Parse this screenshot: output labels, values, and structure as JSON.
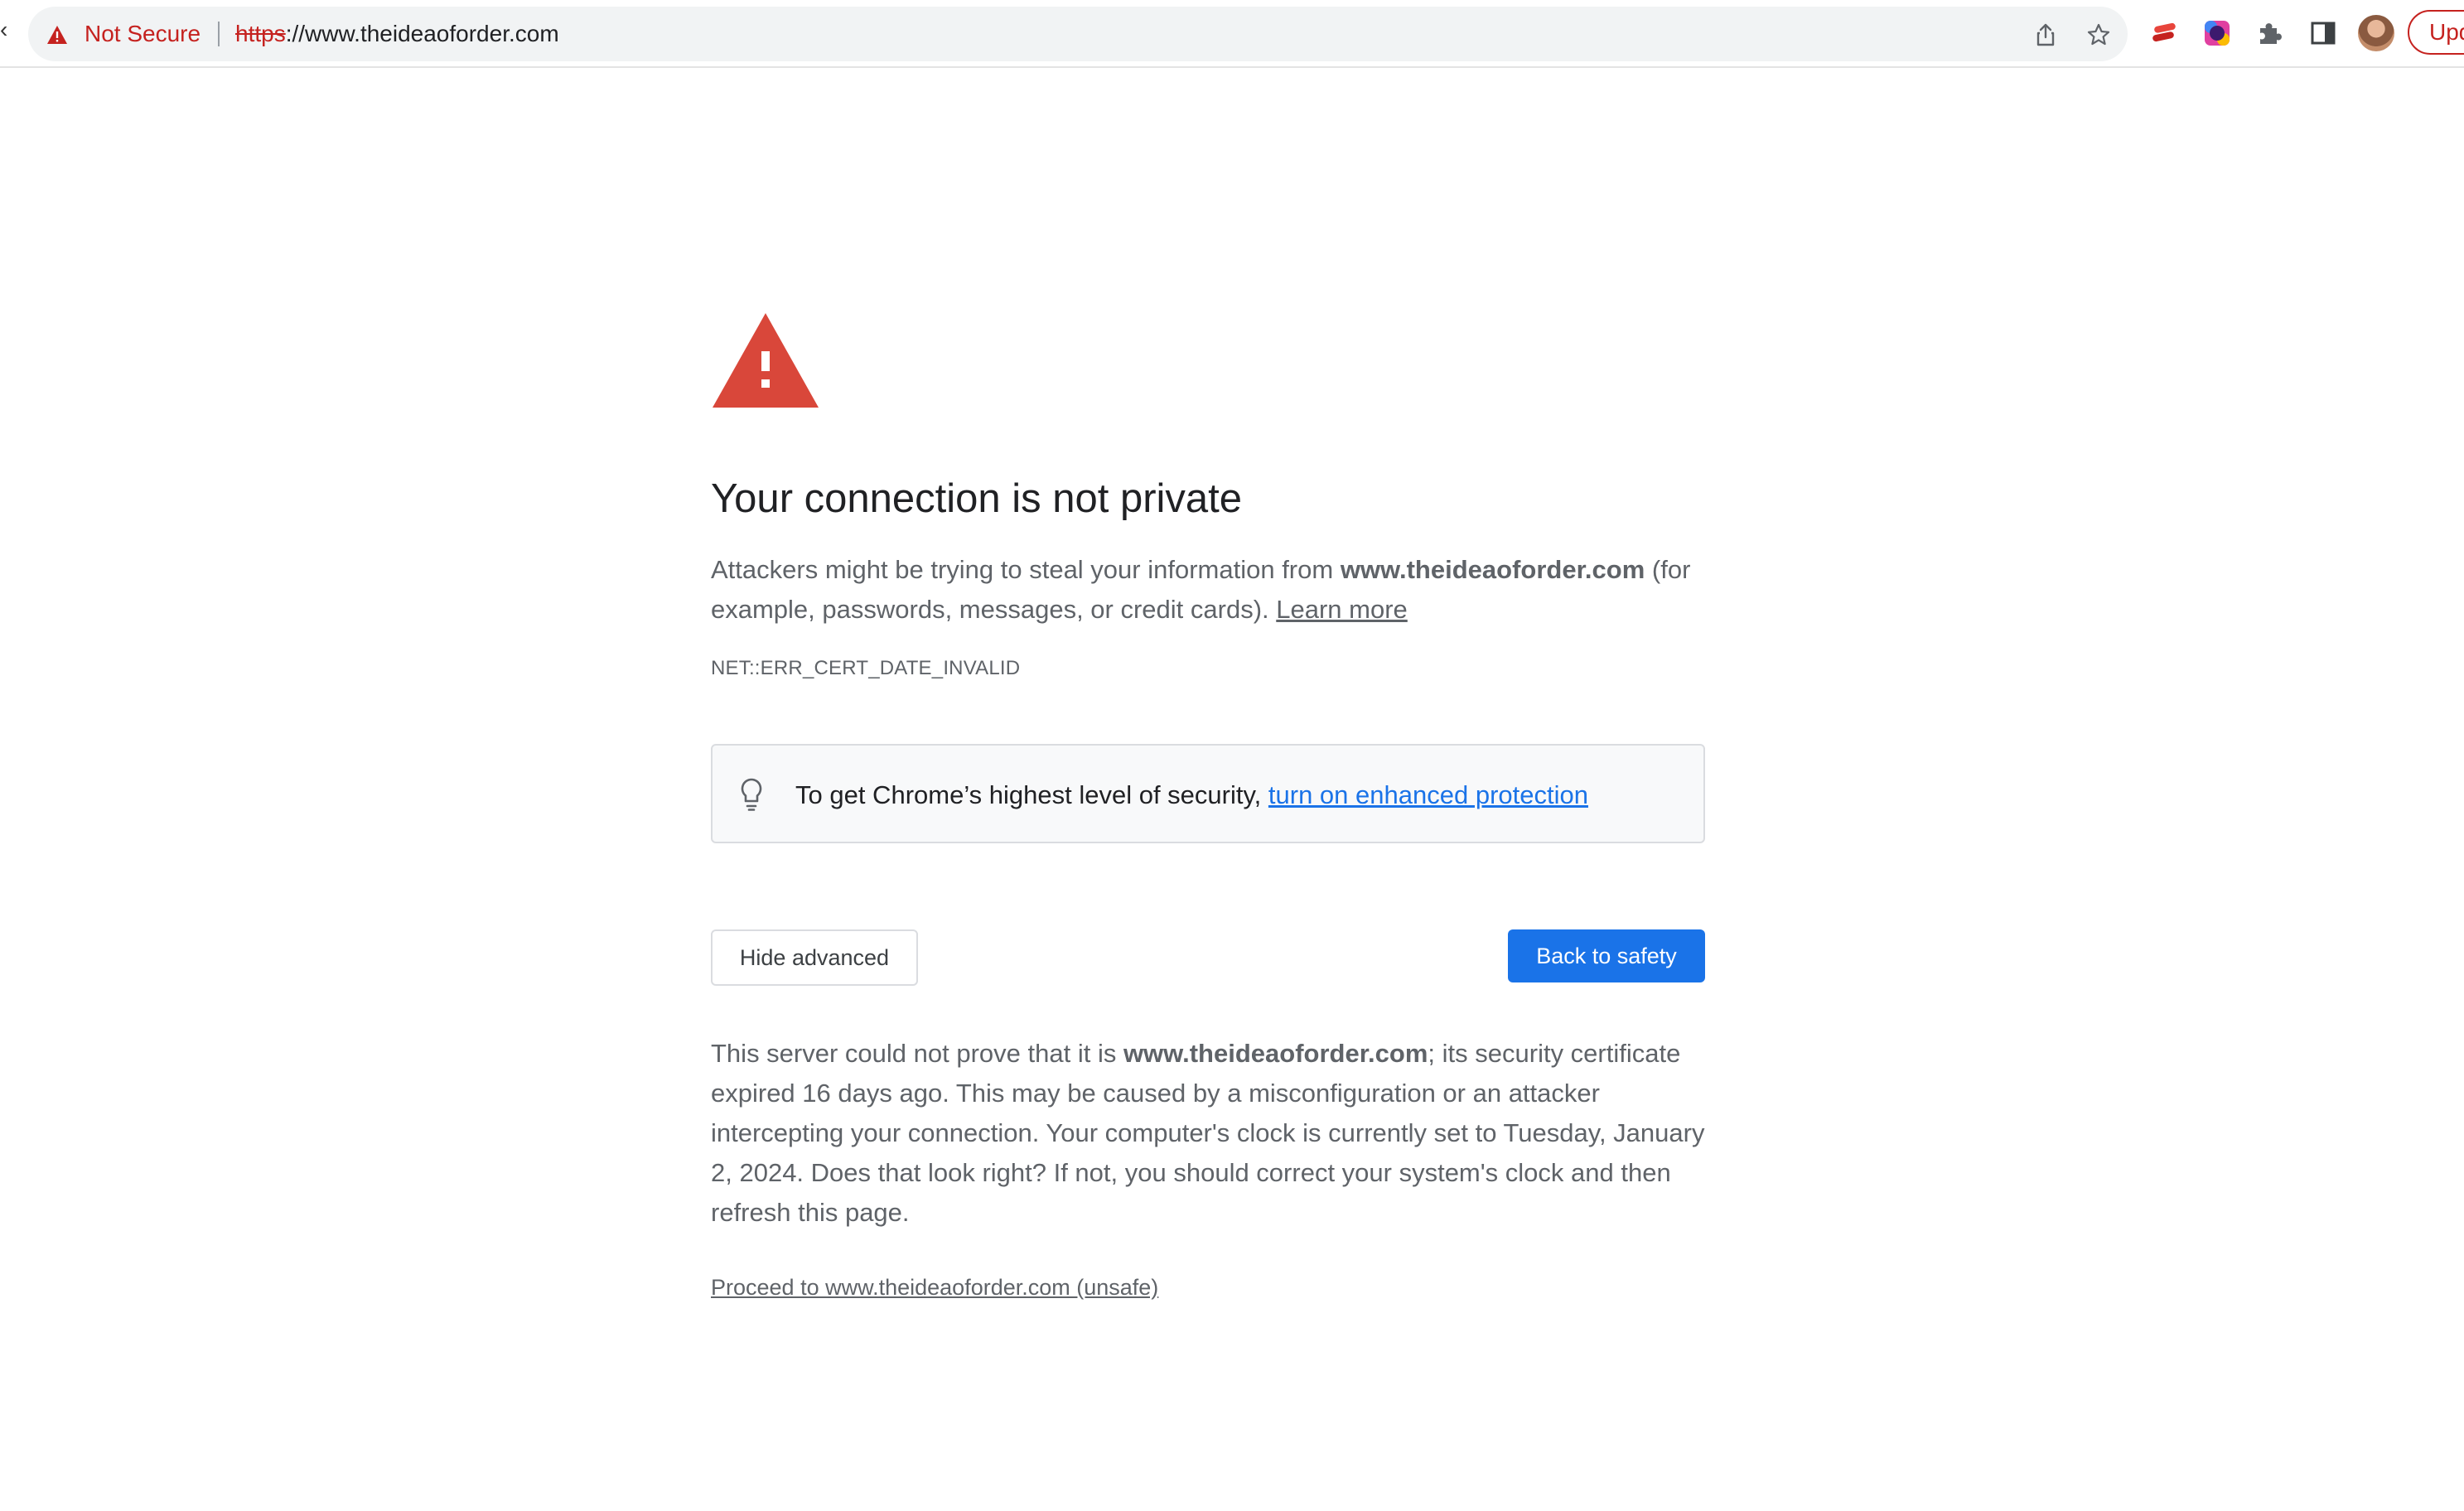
{
  "browser": {
    "security_chip": "Not Secure",
    "url_scheme": "https",
    "url_rest": "://www.theideaoforder.com",
    "update_label": "Upd",
    "accent_color": "#1a73e8",
    "warning_color": "#c5221f"
  },
  "interstitial": {
    "icon": "warning-triangle-icon",
    "heading": "Your connection is not private",
    "message_before": "Attackers might be trying to steal your information from ",
    "message_domain": "www.theideaoforder.com",
    "message_after": " (for example, passwords, messages, or credit cards). ",
    "learn_more": "Learn more",
    "error_code": "NET::ERR_CERT_DATE_INVALID",
    "enhanced_text": "To get Chrome’s highest level of security, ",
    "enhanced_link": "turn on enhanced protection",
    "hide_advanced": "Hide advanced",
    "back_to_safety": "Back to safety",
    "details_before": "This server could not prove that it is ",
    "details_domain": "www.theideaoforder.com",
    "details_after": "; its security certificate expired 16 days ago. This may be caused by a misconfiguration or an attacker intercepting your connection. Your computer's clock is currently set to Tuesday, January 2, 2024. Does that look right? If not, you should correct your system's clock and then refresh this page.",
    "proceed_link": "Proceed to www.theideaoforder.com (unsafe)"
  }
}
